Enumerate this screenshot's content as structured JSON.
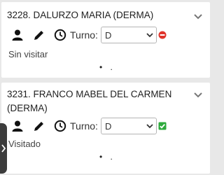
{
  "patients": [
    {
      "title": "3228. DALURZO MARIA (DERMA)",
      "turno_label": "Turno:",
      "turno_value": "D",
      "status_text": "Sin visitar",
      "status_icon": "red-minus-circle-icon",
      "status_color": "#e0342b",
      "pager_dots": "• ."
    },
    {
      "title": "3231. FRANCO MABEL DEL CARMEN (DERMA)",
      "turno_label": "Turno:",
      "turno_value": "D",
      "status_text": "Visitado",
      "status_icon": "green-check-square-icon",
      "status_color": "#2eaa3c",
      "pager_dots": "• ."
    }
  ],
  "side_tab_icon": "chevron-right-icon"
}
